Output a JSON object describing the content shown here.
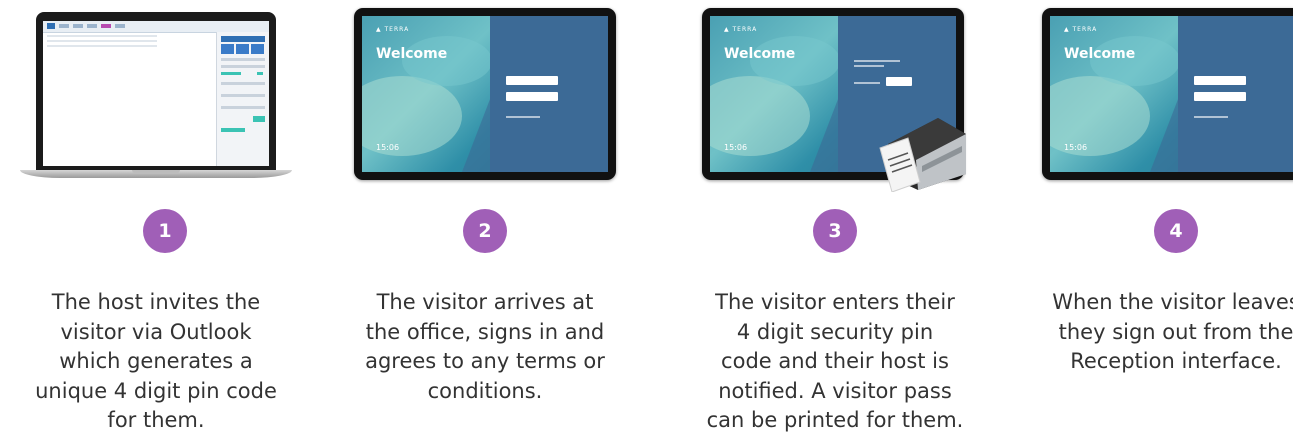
{
  "steps": [
    {
      "number": "1",
      "caption_lines": [
        "The host invites the",
        "visitor via Outlook",
        "which generates a",
        "unique 4 digit pin code",
        "for them."
      ]
    },
    {
      "number": "2",
      "caption_lines": [
        "The visitor arrives at",
        "the office, signs in and",
        "agrees to any terms or",
        "conditions."
      ]
    },
    {
      "number": "3",
      "caption_lines": [
        "The visitor enters their",
        "4 digit security pin",
        "code and their host is",
        "notified. A visitor pass",
        "can be printed for them."
      ]
    },
    {
      "number": "4",
      "caption_lines": [
        "When the visitor leaves",
        "they sign out from the",
        "Reception interface."
      ]
    }
  ],
  "kiosk": {
    "welcome": "Welcome",
    "time": "15:06"
  },
  "colors": {
    "badge": "#a05fb7",
    "caption_text": "#333333",
    "panel_blue": "#3c6a96"
  }
}
